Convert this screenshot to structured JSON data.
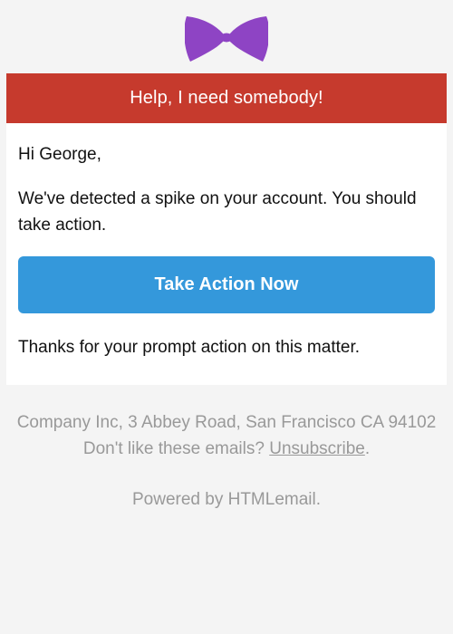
{
  "brand": {
    "logo_icon": "bowtie-icon",
    "logo_color": "#8e44c4"
  },
  "alert": {
    "text": "Help, I need somebody!",
    "color": "#c63a2d"
  },
  "email": {
    "greeting": "Hi George,",
    "message": "We've detected a spike on your account. You should take action.",
    "button_label": "Take Action Now",
    "button_color": "#3498db",
    "closing": "Thanks for your prompt action on this matter."
  },
  "footer": {
    "address": "Company Inc, 3 Abbey Road, San Francisco CA 94102",
    "unsubscribe_prefix": "Don't like these emails?",
    "unsubscribe_label": "Unsubscribe",
    "unsubscribe_suffix": ".",
    "powered_prefix": "Powered by ",
    "powered_brand": "HTMLemail",
    "powered_suffix": "."
  }
}
